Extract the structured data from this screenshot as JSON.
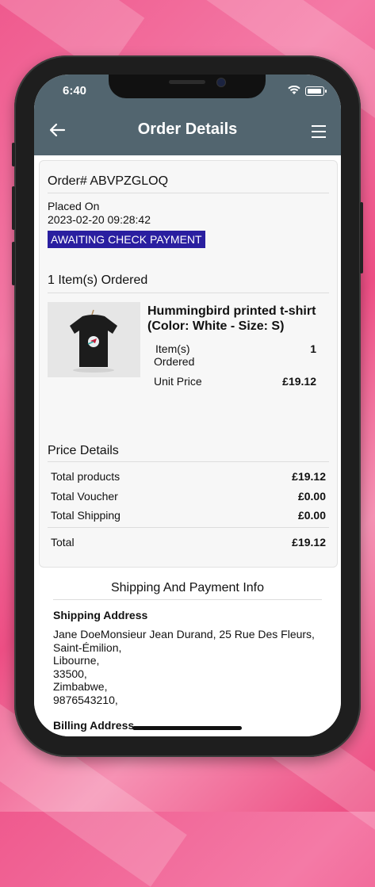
{
  "status_bar": {
    "time": "6:40"
  },
  "app_bar": {
    "title": "Order Details"
  },
  "order": {
    "number_label": "Order#  ABVPZGLOQ",
    "placed_label": "Placed On",
    "placed_date": "2023-02-20 09:28:42",
    "status": "AWAITING CHECK PAYMENT",
    "status_color": "#2a1fa0"
  },
  "items": {
    "heading": "1  Item(s) Ordered",
    "product": {
      "name": "Hummingbird printed t-shirt (Color: White - Size: S)",
      "qty_label_1": "Item(s)",
      "qty_label_2": "Ordered",
      "qty_value": "1",
      "unit_price_label": "Unit Price",
      "unit_price_value": "£19.12"
    }
  },
  "price_details": {
    "heading": "Price Details",
    "rows": [
      {
        "label": "Total products",
        "value": "£19.12"
      },
      {
        "label": "Total Voucher",
        "value": "£0.00"
      },
      {
        "label": "Total Shipping",
        "value": "£0.00"
      }
    ],
    "total_label": "Total",
    "total_value": "£19.12"
  },
  "shipping": {
    "heading": "Shipping And Payment Info",
    "shipping_address_label": "Shipping Address",
    "address_lines": [
      "Jane DoeMonsieur Jean Durand, 25 Rue Des Fleurs,",
      "Saint-Émilion,",
      "Libourne,",
      "33500,",
      "Zimbabwe,",
      "9876543210,"
    ],
    "billing_address_label": "Billing Address"
  },
  "colors": {
    "app_bar": "#52656f",
    "background_accent": "#ef5a8e"
  }
}
